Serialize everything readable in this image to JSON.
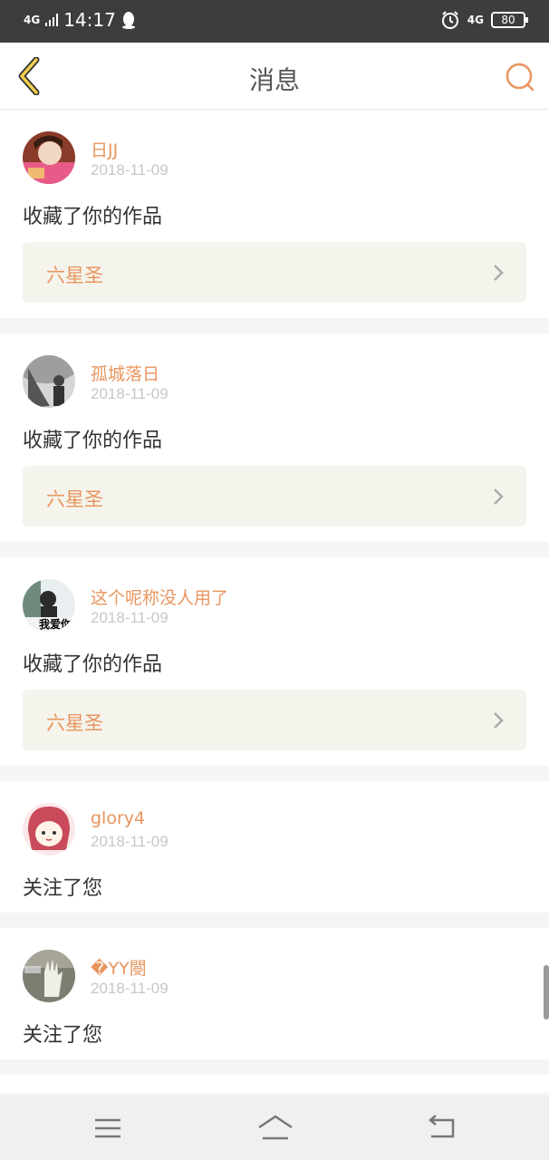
{
  "status_bar": {
    "time": "14:17",
    "network_left": "4G",
    "network_right": "4G",
    "battery": "80"
  },
  "header": {
    "title": "消息"
  },
  "notifications": [
    {
      "user": "日JJ",
      "date": "2018-11-09",
      "action": "收藏了你的作品",
      "work_title": "六星圣"
    },
    {
      "user": "孤城落日",
      "date": "2018-11-09",
      "action": "收藏了你的作品",
      "work_title": "六星圣"
    },
    {
      "user": "这个呢称没人用了",
      "date": "2018-11-09",
      "action": "收藏了你的作品",
      "work_title": "六星圣",
      "avatar_caption": "我爱你"
    },
    {
      "user": "glory4",
      "date": "2018-11-09",
      "action": "关注了您"
    },
    {
      "user": "�YY閿",
      "date": "2018-11-09",
      "action": "关注了您"
    }
  ],
  "colors": {
    "accent": "#e8955e",
    "status_bar": "#3d3d3d",
    "work_bg": "#f5f4ec",
    "back_icon": "#d9b84a"
  },
  "icons": {
    "back": "back-chevron-icon",
    "search": "search-icon",
    "menu": "menu-icon",
    "home": "home-icon",
    "return": "return-icon"
  }
}
